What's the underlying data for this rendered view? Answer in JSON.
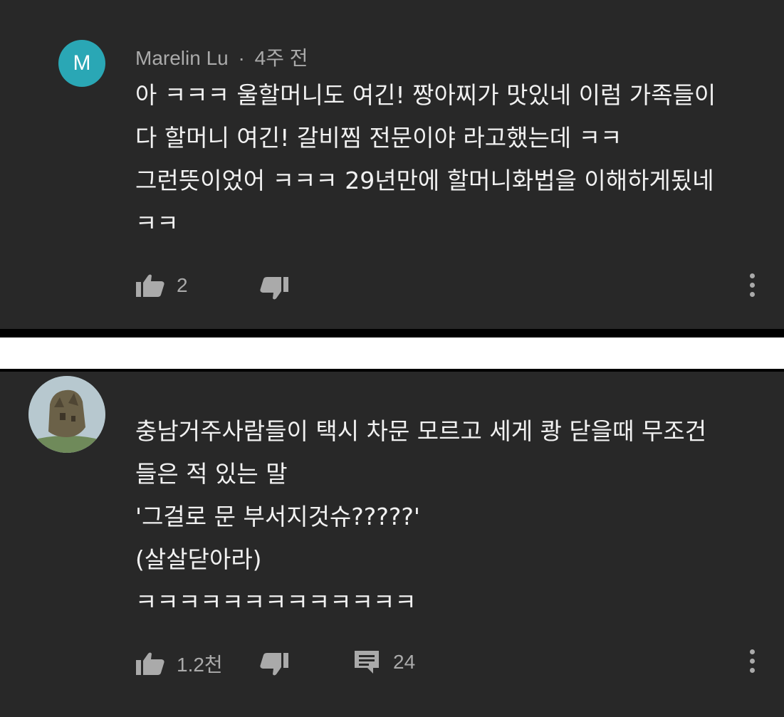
{
  "comments": [
    {
      "avatar_letter": "M",
      "author": "Marelin Lu",
      "separator": "·",
      "time": "4주 전",
      "text": "아 ㅋㅋㅋ 울할머니도 여긴! 짱아찌가 맛있네 이럼 가족들이\n다 할머니 여긴! 갈비찜 전문이야 라고했는데 ㅋㅋ\n그런뜻이었어 ㅋㅋㅋ 29년만에 할머니화법을 이해하게됬네\nㅋㅋ",
      "likes": "2"
    },
    {
      "text": "충남거주사람들이 택시 차문 모르고 세게 쾅 닫을때 무조건\n들은 적 있는 말\n'그걸로 문 부서지것슈?????'\n(살살닫아라)\nㅋㅋㅋㅋㅋㅋㅋㅋㅋㅋㅋㅋㅋ",
      "likes": "1.2천",
      "replies": "24"
    }
  ],
  "colors": {
    "background": "#282828",
    "text": "#f1f1f1",
    "secondary": "#aaaaaa",
    "avatar": "#2aa7b5"
  }
}
